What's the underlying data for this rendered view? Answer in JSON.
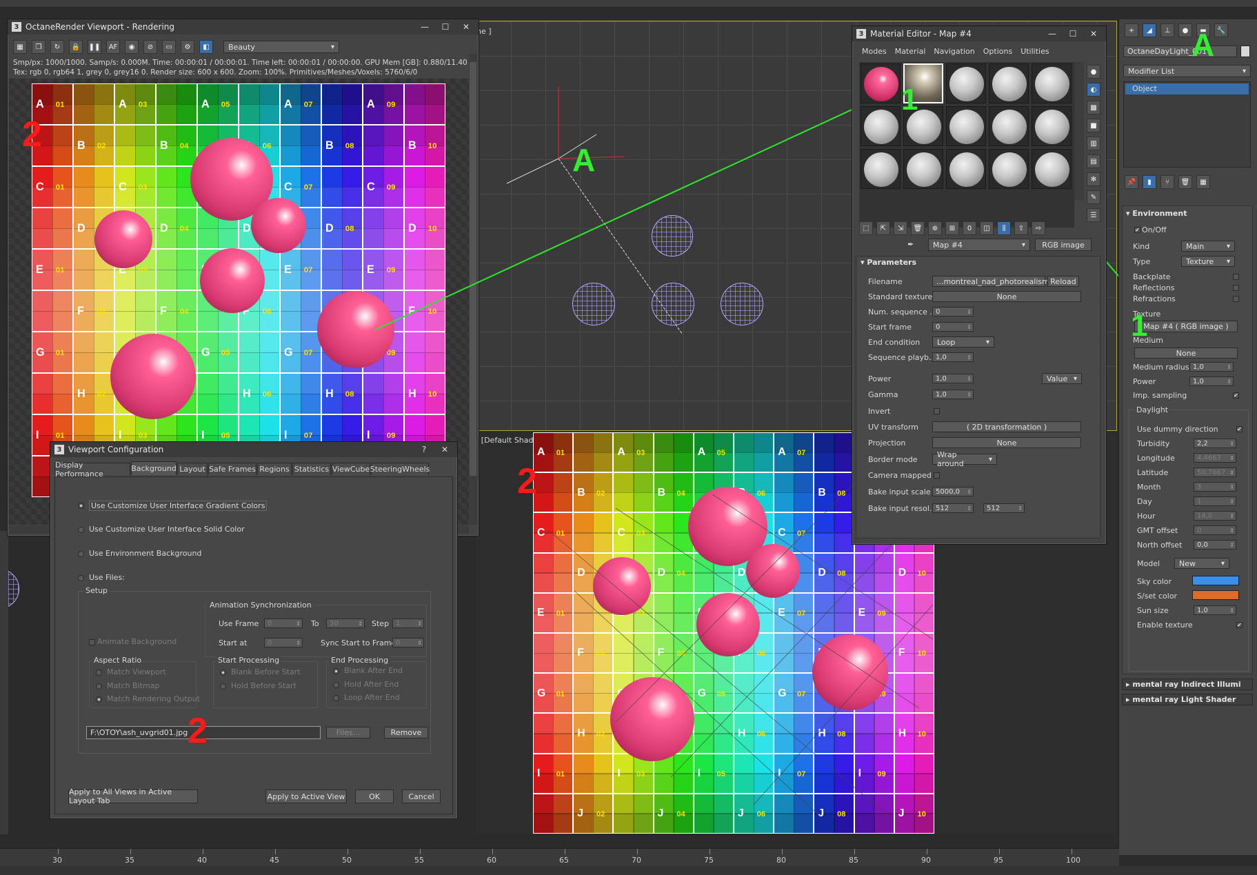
{
  "octane": {
    "title": "OctaneRender Viewport - Rendering",
    "pass": "Beauty",
    "stats1": "Smp/px: 1000/1000.   Samp/s: 0.000M.   Time: 00:00:01 / 00:00:01.   Time left: 00:00:01 / 00:00:00.   GPU Mem [GB]: 0.880/11.40",
    "stats2": "Tex: rgb 0, rgb64 1, grey 0, grey16 0.   Render size: 600 x 600.   Zoom: 100%.   Primitives/Meshes/Voxels: 5760/6/0"
  },
  "viewport_bottom_label": "] [Default Shading ]",
  "viewport_top_label": "ne ]",
  "uvgrid": {
    "rows": [
      "A",
      "B",
      "C",
      "D",
      "E",
      "F",
      "G",
      "H",
      "I",
      "J"
    ],
    "nums": [
      "01",
      "02",
      "03",
      "04",
      "05",
      "06",
      "07",
      "08",
      "09",
      "10"
    ]
  },
  "annotations": {
    "a": "A",
    "one": "1",
    "two": "2"
  },
  "matEditor": {
    "title": "Material Editor - Map #4",
    "menu": [
      "Modes",
      "Material",
      "Navigation",
      "Options",
      "Utilities"
    ],
    "map_name": "Map #4",
    "map_type": "RGB image",
    "section": "Parameters",
    "filename_label": "Filename",
    "filename_value": "...montreal_nad_photorealism.exr",
    "reload": "Reload",
    "std_tex_label": "Standard texture",
    "std_tex_value": "None",
    "num_seq_label": "Num. sequence ...",
    "num_seq_value": "0",
    "start_frame_label": "Start frame",
    "start_frame_value": "0",
    "end_cond_label": "End condition",
    "end_cond_value": "Loop",
    "seq_play_label": "Sequence playb...",
    "seq_play_value": "1,0",
    "power_label": "Power",
    "power_value": "1,0",
    "power_mode": "Value",
    "gamma_label": "Gamma",
    "gamma_value": "1,0",
    "invert_label": "Invert",
    "uv_label": "UV transform",
    "uv_value": "( 2D transformation )",
    "proj_label": "Projection",
    "proj_value": "None",
    "border_label": "Border mode",
    "border_value": "Wrap around",
    "cam_label": "Camera mapped",
    "bake_scale_label": "Bake input scale",
    "bake_scale_value": "5000,0",
    "bake_res_label": "Bake input resol...",
    "bake_res_w": "512",
    "bake_res_h": "512"
  },
  "cmdPanel": {
    "object_name": "OctaneDayLight_001",
    "modifier_list": "Modifier List",
    "stack_item": "Object",
    "env_section": "Environment",
    "onoff": "On/Off",
    "kind_label": "Kind",
    "kind_value": "Main",
    "type_label": "Type",
    "type_value": "Texture",
    "backplate": "Backplate",
    "reflections": "Reflections",
    "refractions": "Refractions",
    "texture_label": "Texture",
    "texture_value": "Map #4  ( RGB image )",
    "medium_label": "Medium",
    "medium_value": "None",
    "medium_radius_label": "Medium radius",
    "medium_radius_value": "1,0",
    "power_label": "Power",
    "power_value": "1,0",
    "imp_label": "Imp. sampling",
    "daylight": "Daylight",
    "dummy_label": "Use dummy direction",
    "turbidity_label": "Turbidity",
    "turbidity_value": "2,2",
    "longitude_label": "Longitude",
    "longitude_value": "4,4667",
    "latitude_label": "Latitude",
    "latitude_value": "50,7667",
    "month_label": "Month",
    "month_value": "3",
    "day_label": "Day",
    "day_value": "1",
    "hour_label": "Hour",
    "hour_value": "14,0",
    "gmt_label": "GMT offset",
    "gmt_value": "0",
    "north_label": "North offset",
    "north_value": "0,0",
    "model_label": "Model",
    "model_value": "New",
    "sky_label": "Sky color",
    "sky_color": "#3c8ee8",
    "sset_label": "S/set color",
    "sset_color": "#e06a28",
    "sunsize_label": "Sun size",
    "sunsize_value": "1,0",
    "enable_tex_label": "Enable texture",
    "rollout1": "mental ray Indirect Illumi",
    "rollout2": "mental ray Light Shader"
  },
  "vpConfig": {
    "title": "Viewport Configuration",
    "tabs": [
      "Display Performance",
      "Background",
      "Layout",
      "Safe Frames",
      "Regions",
      "Statistics",
      "ViewCube",
      "SteeringWheels"
    ],
    "opt1": "Use Customize User Interface Gradient Colors",
    "opt2": "Use Customize User Interface Solid Color",
    "opt3": "Use Environment Background",
    "opt4": "Use Files:",
    "setup": "Setup",
    "anim_sync": "Animation Synchronization",
    "use_frame": "Use Frame",
    "use_frame_from": "0",
    "to": "To",
    "use_frame_to": "30",
    "step": "Step",
    "step_value": "1",
    "start_at": "Start at",
    "start_at_value": "0",
    "sync_start": "Sync Start to Frame",
    "sync_start_value": "0",
    "animate_bg": "Animate Background",
    "aspect": "Aspect Ratio",
    "match_viewport": "Match Viewport",
    "match_bitmap": "Match Bitmap",
    "match_render": "Match Rendering Output",
    "start_proc": "Start Processing",
    "blank_before": "Blank Before Start",
    "hold_before": "Hold Before Start",
    "end_proc": "End Processing",
    "blank_after": "Blank After End",
    "hold_after": "Hold After End",
    "loop_after": "Loop After End",
    "file_path": "F:\\OTOY\\ash_uvgrid01.jpg",
    "files_btn": "Files...",
    "remove_btn": "Remove",
    "apply_all": "Apply to All Views in Active Layout Tab",
    "apply_active": "Apply to Active View",
    "ok": "OK",
    "cancel": "Cancel"
  },
  "timeline": {
    "ticks": [
      "30",
      "35",
      "40",
      "45",
      "50",
      "55",
      "60",
      "65",
      "70",
      "75",
      "80",
      "85",
      "90",
      "95",
      "100"
    ]
  }
}
